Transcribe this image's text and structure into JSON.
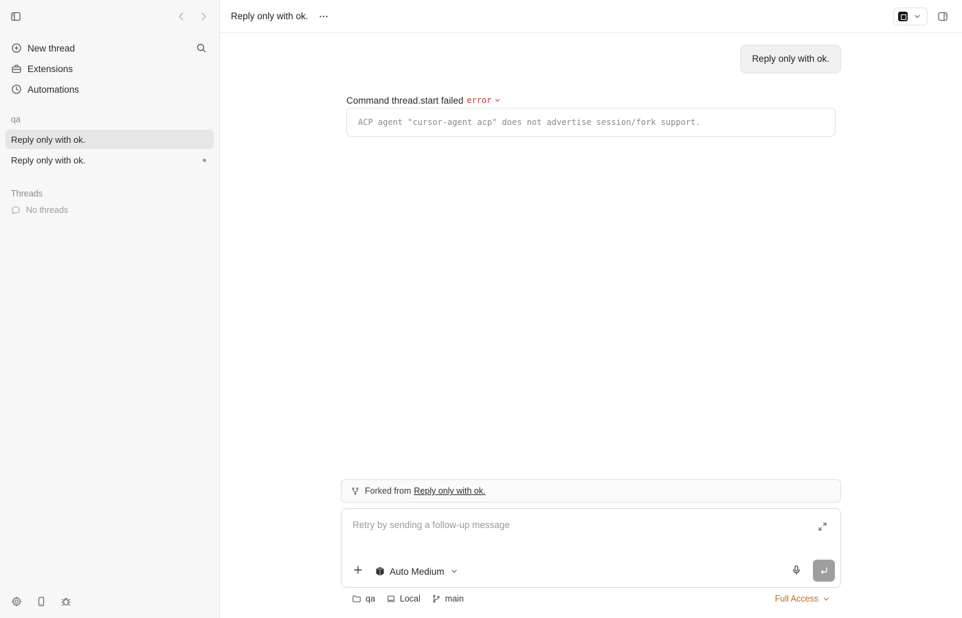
{
  "sidebar": {
    "nav": [
      {
        "label": "New thread",
        "icon": "plus-circle-icon"
      },
      {
        "label": "Extensions",
        "icon": "toolbox-icon"
      },
      {
        "label": "Automations",
        "icon": "clock-icon"
      }
    ],
    "project_label": "qa",
    "threads": [
      {
        "label": "Reply only with ok.",
        "active": true
      },
      {
        "label": "Reply only with ok.",
        "active": false,
        "unread": true
      }
    ],
    "threads_section_label": "Threads",
    "empty_threads_label": "No threads"
  },
  "header": {
    "title": "Reply only with ok."
  },
  "conversation": {
    "user_message": "Reply only with ok.",
    "command": {
      "title": "Command thread.start failed",
      "status": "error",
      "output": "ACP agent \"cursor-agent acp\" does not advertise session/fork support."
    }
  },
  "fork_notice": {
    "prefix": "Forked from",
    "link": "Reply only with ok."
  },
  "composer": {
    "placeholder": "Retry by sending a follow-up message",
    "model": "Auto Medium"
  },
  "footer": {
    "project": "qa",
    "environment": "Local",
    "branch": "main",
    "access": "Full Access"
  },
  "colors": {
    "error": "#c0362c",
    "access": "#c26a16",
    "sidebar_bg": "#f7f7f7",
    "active_item_bg": "#e6e6e6",
    "send_button": "#9e9e9e"
  }
}
